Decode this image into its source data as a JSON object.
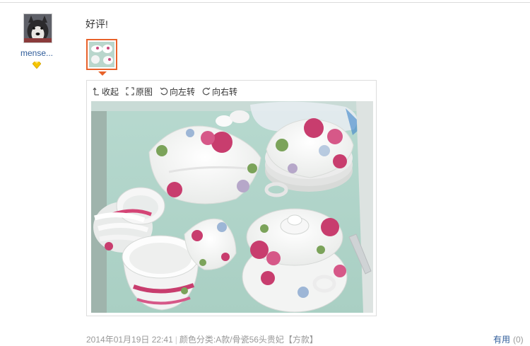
{
  "user": {
    "name": "mense...",
    "avatar_icon": "dog-avatar",
    "badge_icon": "diamond-icon",
    "badge_color": "#f5c400"
  },
  "review": {
    "text": "好评!"
  },
  "viewer": {
    "collapse_label": "收起",
    "original_label": "原图",
    "rotate_left_label": "向左转",
    "rotate_right_label": "向右转"
  },
  "meta": {
    "date": "2014年01月19日 22:41",
    "spec": "颜色分类:A款/骨瓷56头贵妃【方款】"
  },
  "useful": {
    "label": "有用",
    "count": "(0)"
  },
  "colors": {
    "accent": "#e8622a",
    "link": "#2f5c9a"
  }
}
